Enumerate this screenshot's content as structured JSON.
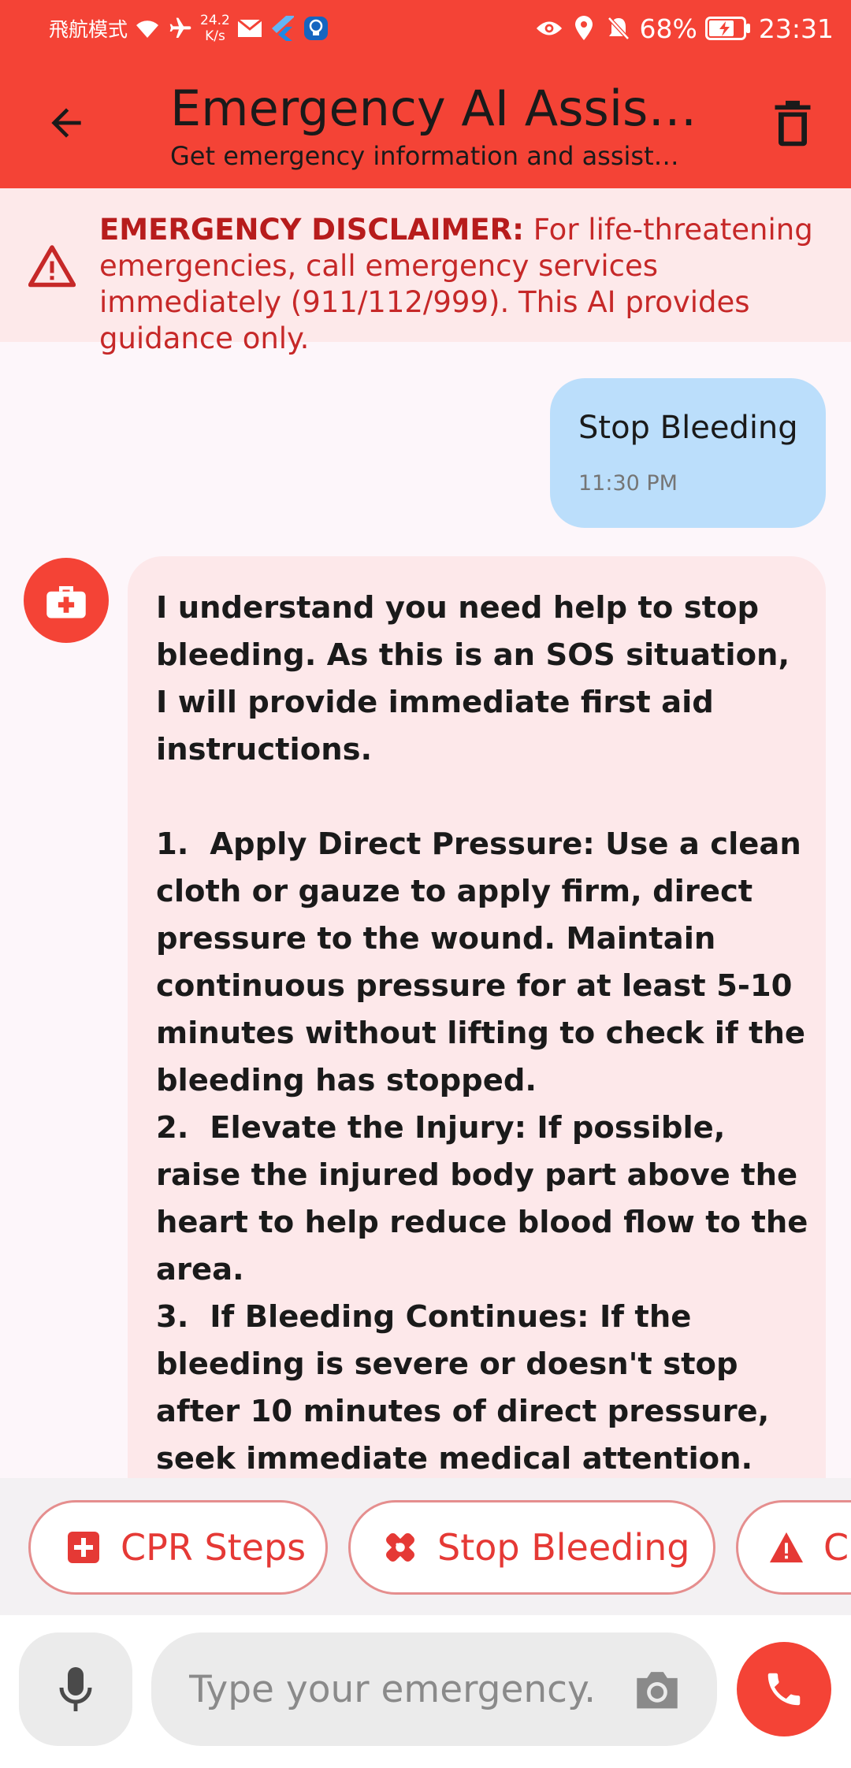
{
  "status_bar": {
    "airplane_mode_label": "飛航模式",
    "net_speed_value": "24.2",
    "net_speed_unit": "K/s",
    "battery": "68%",
    "time": "23:31"
  },
  "app_bar": {
    "title": "Emergency AI Assistant",
    "subtitle": "Get emergency information and assistance"
  },
  "disclaimer": {
    "heading": "EMERGENCY DISCLAIMER:",
    "body": " For life-threatening emergencies, call emergency services immediately (911/112/999). This AI provides guidance only."
  },
  "messages": {
    "user": {
      "text": "Stop Bleeding",
      "time": "11:30 PM"
    },
    "assistant": {
      "text": "I understand you need help to stop bleeding. As this is an SOS situation, I will provide immediate first aid instructions.\n\n1.  Apply Direct Pressure: Use a clean cloth or gauze to apply firm, direct pressure to the wound. Maintain continuous pressure for at least 5-10 minutes without lifting to check if the bleeding has stopped.\n2.  Elevate the Injury: If possible, raise the injured body part above the heart to help reduce blood flow to the area.\n3.  If Bleeding Continues: If the bleeding is severe or doesn't stop after 10 minutes of direct pressure, seek immediate medical attention. Call emergency services."
    }
  },
  "quick_actions": [
    {
      "label": "CPR Steps",
      "icon": "medical-cross-icon"
    },
    {
      "label": "Stop Bleeding",
      "icon": "bandage-icon"
    },
    {
      "label": "C",
      "icon": "warning-icon"
    }
  ],
  "input": {
    "placeholder": "Type your emergency..."
  },
  "colors": {
    "primary": "#f44336",
    "user_bubble": "#bbdefb",
    "assistant_bubble": "#fde8ea",
    "disclaimer_bg": "#fde9ea"
  }
}
